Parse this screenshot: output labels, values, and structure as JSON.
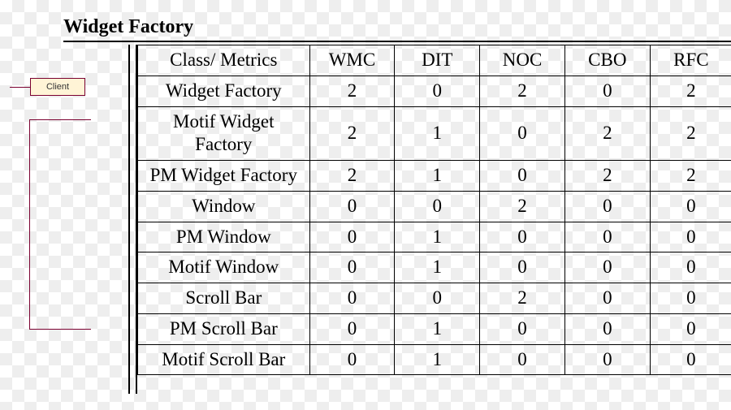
{
  "title": "Widget Factory",
  "client_label": "Client",
  "table": {
    "headers": [
      "Class/ Metrics",
      "WMC",
      "DIT",
      "NOC",
      "CBO",
      "RFC"
    ],
    "rows": [
      {
        "class": "Widget Factory",
        "wmc": "2",
        "dit": "0",
        "noc": "2",
        "cbo": "0",
        "rfc": "2"
      },
      {
        "class": "Motif Widget Factory",
        "wmc": "2",
        "dit": "1",
        "noc": "0",
        "cbo": "2",
        "rfc": "2"
      },
      {
        "class": "PM Widget Factory",
        "wmc": "2",
        "dit": "1",
        "noc": "0",
        "cbo": "2",
        "rfc": "2"
      },
      {
        "class": "Window",
        "wmc": "0",
        "dit": "0",
        "noc": "2",
        "cbo": "0",
        "rfc": "0"
      },
      {
        "class": "PM Window",
        "wmc": "0",
        "dit": "1",
        "noc": "0",
        "cbo": "0",
        "rfc": "0"
      },
      {
        "class": "Motif Window",
        "wmc": "0",
        "dit": "1",
        "noc": "0",
        "cbo": "0",
        "rfc": "0"
      },
      {
        "class": "Scroll Bar",
        "wmc": "0",
        "dit": "0",
        "noc": "2",
        "cbo": "0",
        "rfc": "0"
      },
      {
        "class": "PM Scroll Bar",
        "wmc": "0",
        "dit": "1",
        "noc": "0",
        "cbo": "0",
        "rfc": "0"
      },
      {
        "class": "Motif Scroll Bar",
        "wmc": "0",
        "dit": "1",
        "noc": "0",
        "cbo": "0",
        "rfc": "0"
      }
    ]
  },
  "chart_data": {
    "type": "table",
    "title": "Widget Factory",
    "columns": [
      "Class/ Metrics",
      "WMC",
      "DIT",
      "NOC",
      "CBO",
      "RFC"
    ],
    "rows": [
      [
        "Widget Factory",
        2,
        0,
        2,
        0,
        2
      ],
      [
        "Motif Widget Factory",
        2,
        1,
        0,
        2,
        2
      ],
      [
        "PM Widget Factory",
        2,
        1,
        0,
        2,
        2
      ],
      [
        "Window",
        0,
        0,
        2,
        0,
        0
      ],
      [
        "PM Window",
        0,
        1,
        0,
        0,
        0
      ],
      [
        "Motif Window",
        0,
        1,
        0,
        0,
        0
      ],
      [
        "Scroll Bar",
        0,
        0,
        2,
        0,
        0
      ],
      [
        "PM Scroll Bar",
        0,
        1,
        0,
        0,
        0
      ],
      [
        "Motif Scroll Bar",
        0,
        1,
        0,
        0,
        0
      ]
    ]
  }
}
